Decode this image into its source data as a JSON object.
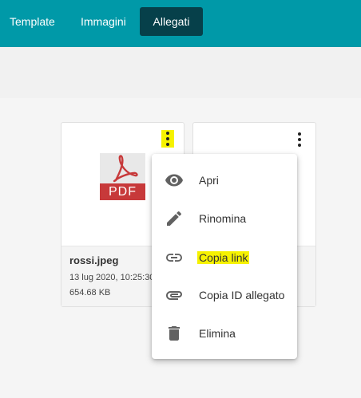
{
  "tabs": [
    {
      "label": "Template",
      "active": false
    },
    {
      "label": "Immagini",
      "active": false
    },
    {
      "label": "Allegati",
      "active": true
    }
  ],
  "colors": {
    "topbar": "#0099a8",
    "active_tab": "#06404a",
    "highlight": "#f6f200",
    "pdf_red": "#c7393a"
  },
  "file_card": {
    "thumbnail_label": "PDF",
    "name": "rossi.jpeg",
    "date": "13 lug 2020, 10:25:30",
    "size": "654.68 KB",
    "menu_icon": "more-vert-icon"
  },
  "context_menu": {
    "items": [
      {
        "label": "Apri",
        "icon": "eye-icon"
      },
      {
        "label": "Rinomina",
        "icon": "pencil-icon"
      },
      {
        "label": "Copia link",
        "icon": "link-icon",
        "highlighted": true
      },
      {
        "label": "Copia ID allegato",
        "icon": "paperclip-icon"
      },
      {
        "label": "Elimina",
        "icon": "trash-icon"
      }
    ]
  }
}
